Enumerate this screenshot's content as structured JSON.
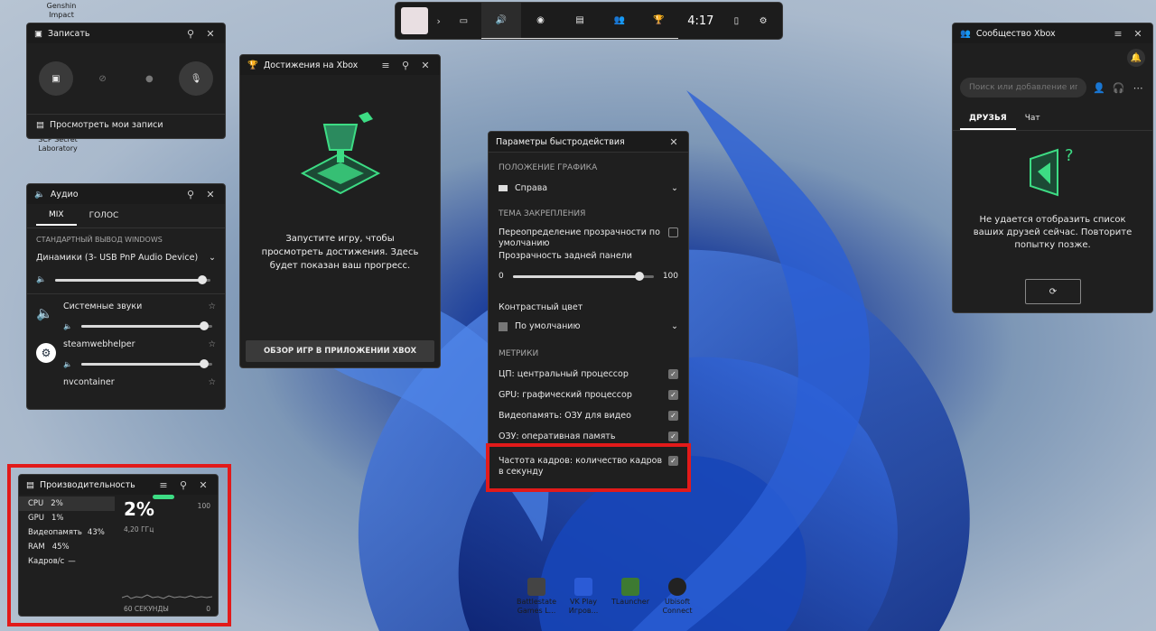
{
  "bar": {
    "time": "4:17"
  },
  "capture": {
    "title": "Записать",
    "view_recordings": "Просмотреть мои записи"
  },
  "audio": {
    "title": "Аудио",
    "tabs": [
      "MIX",
      "ГОЛОС"
    ],
    "output_label": "СТАНДАРТНЫЙ ВЫВОД WINDOWS",
    "device": "Динамики (3- USB PnP Audio Device)",
    "master_level": 0.95,
    "apps": [
      {
        "name": "Системные звуки",
        "level": 0.94
      },
      {
        "name": "steamwebhelper",
        "level": 0.94
      },
      {
        "name": "nvcontainer"
      }
    ]
  },
  "achievements": {
    "title": "Достижения на Xbox",
    "message": "Запустите игру, чтобы просмотреть достижения. Здесь будет показан ваш прогресс.",
    "button": "ОБЗОР ИГР В ПРИЛОЖЕНИИ XBOX"
  },
  "perf_settings": {
    "title": "Параметры быстродействия",
    "graph_position_label": "ПОЛОЖЕНИЕ ГРАФИКА",
    "graph_position_value": "Справа",
    "pin_theme_label": "ТЕМА ЗАКРЕПЛЕНИЯ",
    "transparency_override": "Переопределение прозрачности по умолчанию",
    "backdrop_transparency": "Прозрачность задней панели",
    "slider_min": "0",
    "slider_max": "100",
    "slider_value": 0.9,
    "accent_color_label": "Контрастный цвет",
    "accent_color_value": "По умолчанию",
    "metrics_label": "МЕТРИКИ",
    "metrics": [
      "ЦП: центральный процессор",
      "GPU: графический процессор",
      "Видеопамять: ОЗУ для видео",
      "ОЗУ: оперативная память",
      "Частота кадров: количество кадров в секунду"
    ]
  },
  "xbox_social": {
    "title": "Сообщество Xbox",
    "search_placeholder": "Поиск или добавление игр",
    "tabs": [
      "ДРУЗЬЯ",
      "Чат"
    ],
    "error": "Не удается отобразить список ваших друзей сейчас. Повторите попытку позже."
  },
  "performance": {
    "title": "Производительность",
    "rows": [
      {
        "label": "CPU",
        "value": "2%"
      },
      {
        "label": "GPU",
        "value": "1%"
      },
      {
        "label": "Видеопамять",
        "value": "43%"
      },
      {
        "label": "RAM",
        "value": "45%"
      },
      {
        "label": "Кадров/с",
        "value": "—"
      }
    ],
    "big_value": "2%",
    "freq": "4,20 ГГц",
    "max": "100",
    "min": "0",
    "window": "60 СЕКУНДЫ"
  },
  "desktop_icons_left": [
    "Genshin Impact",
    "SCP Secret Laboratory"
  ],
  "desktop_icons_bottom": [
    "Battlestate Games L...",
    "VK Play Игров...",
    "TLauncher",
    "Ubisoft Connect"
  ],
  "colors": {
    "panel": "#1f1f1f",
    "accent_green": "#3ddc84",
    "highlight_red": "#e21a1a"
  }
}
